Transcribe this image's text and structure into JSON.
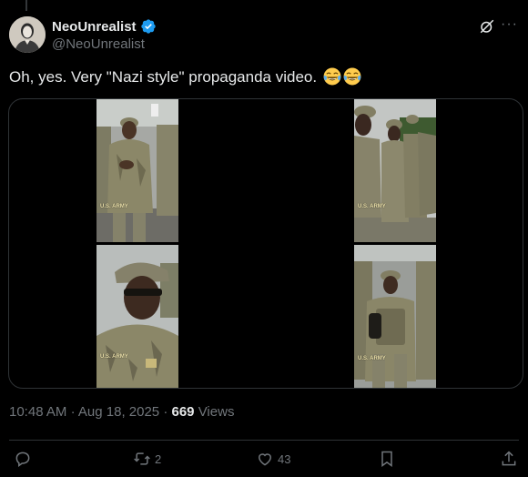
{
  "tweet": {
    "author": {
      "display_name": "NeoUnrealist",
      "handle": "@NeoUnrealist",
      "verified": true
    },
    "text": "Oh, yes. Very \"Nazi style\" propaganda video.",
    "emojis": [
      "face-with-tears-of-joy",
      "face-with-tears-of-joy"
    ],
    "media": {
      "watermark": "U.S. ARMY",
      "frames": 4
    },
    "meta": {
      "time": "10:48 AM",
      "separator": "·",
      "date": "Aug 18, 2025",
      "views_count": "669",
      "views_label": "Views"
    },
    "actions": {
      "reply_count": "",
      "retweet_count": "2",
      "like_count": "43"
    }
  },
  "icons": {
    "grok": "grok-icon",
    "more": "more-icon",
    "reply": "reply-icon",
    "retweet": "retweet-icon",
    "like": "heart-icon",
    "bookmark": "bookmark-icon",
    "share": "share-icon"
  },
  "colors": {
    "background": "#000000",
    "text": "#e7e9ea",
    "muted": "#71767b",
    "border": "#2f3336",
    "verified": "#1d9bf0"
  }
}
